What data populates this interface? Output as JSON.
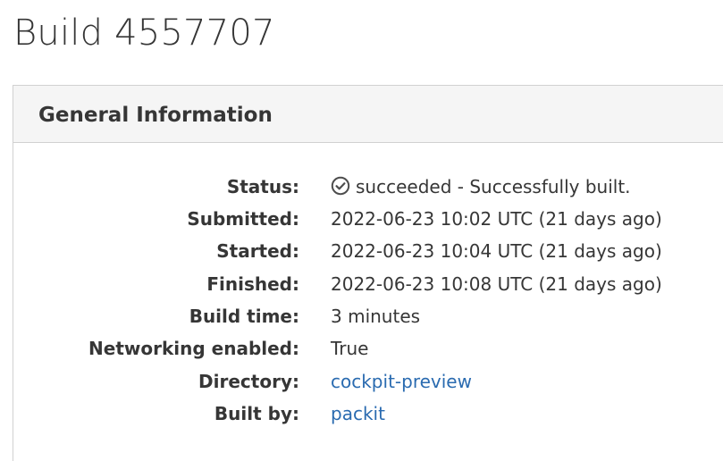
{
  "page": {
    "title": "Build 4557707"
  },
  "panel": {
    "title": "General Information"
  },
  "status_icon": "check-circle-icon",
  "rows": [
    {
      "label": "Status:",
      "value": "succeeded - Successfully built."
    },
    {
      "label": "Submitted:",
      "value": "2022-06-23 10:02 UTC (21 days ago)"
    },
    {
      "label": "Started:",
      "value": "2022-06-23 10:04 UTC (21 days ago)"
    },
    {
      "label": "Finished:",
      "value": "2022-06-23 10:08 UTC (21 days ago)"
    },
    {
      "label": "Build time:",
      "value": "3 minutes"
    },
    {
      "label": "Networking enabled:",
      "value": "True"
    },
    {
      "label": "Directory:",
      "value": "cockpit-preview"
    },
    {
      "label": "Built by:",
      "value": "packit"
    }
  ],
  "colors": {
    "link": "#2a6bb0",
    "text": "#363636",
    "panel_heading_bg": "#f5f5f5",
    "border": "#d1d1d1"
  }
}
